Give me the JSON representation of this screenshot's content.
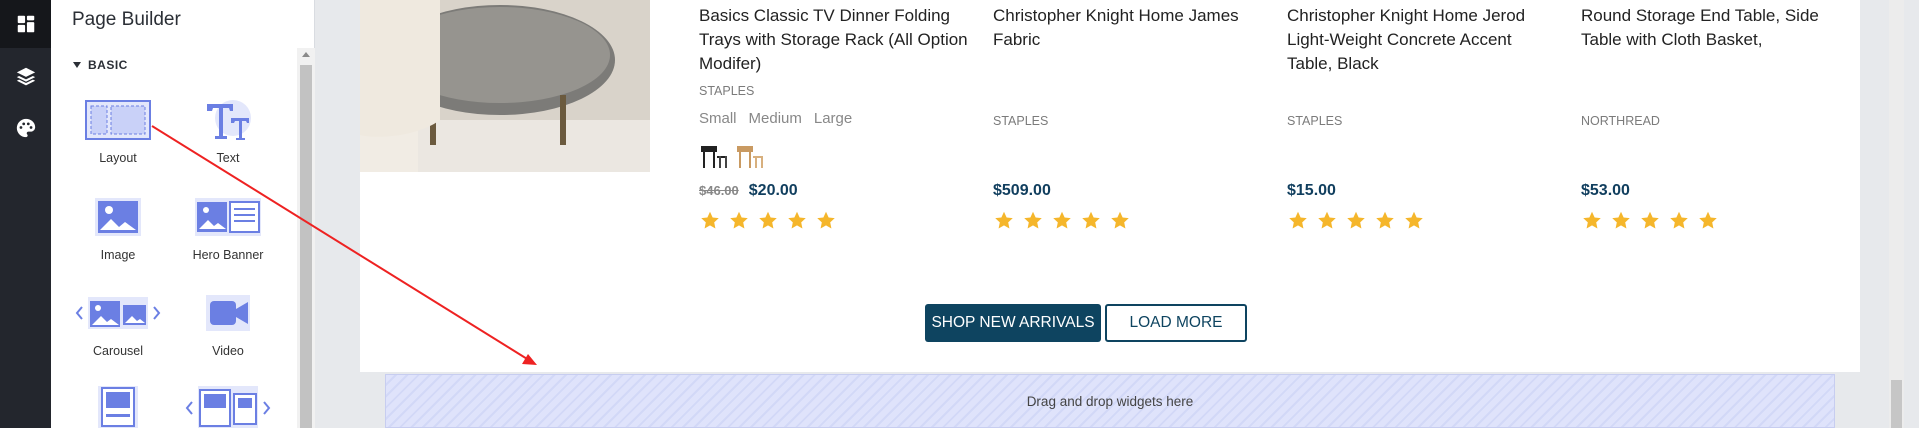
{
  "panel": {
    "title": "Page Builder",
    "section": "BASIC",
    "widgets": [
      {
        "label": "Layout",
        "icon": "layout-icon"
      },
      {
        "label": "Text",
        "icon": "text-icon"
      },
      {
        "label": "Image",
        "icon": "image-icon"
      },
      {
        "label": "Hero Banner",
        "icon": "hero-banner-icon"
      },
      {
        "label": "Carousel",
        "icon": "carousel-icon"
      },
      {
        "label": "Video",
        "icon": "video-icon"
      },
      {
        "label": "",
        "icon": "card-icon"
      },
      {
        "label": "",
        "icon": "card-carousel-icon"
      }
    ]
  },
  "rail": {
    "icons": [
      "dashboard-icon",
      "layers-icon",
      "palette-icon"
    ]
  },
  "products": [
    {
      "title": "Basics Classic TV Dinner Folding Trays with Storage Rack (All Option Modifer)",
      "brand": "STAPLES",
      "sizes": [
        "Small",
        "Medium",
        "Large"
      ],
      "old_price": "$46.00",
      "price": "$20.00",
      "rating": 5
    },
    {
      "title": "Christopher Knight Home James Fabric",
      "brand": "STAPLES",
      "price": "$509.00",
      "rating": 5
    },
    {
      "title": "Christopher Knight Home Jerod Light-Weight Concrete Accent Table, Black",
      "brand": "STAPLES",
      "price": "$15.00",
      "rating": 5
    },
    {
      "title": "Round Storage End Table, Side Table with Cloth Basket,",
      "brand": "NORTHREAD",
      "price": "$53.00",
      "rating": 5
    }
  ],
  "buttons": {
    "shop": "SHOP NEW ARRIVALS",
    "load_more": "LOAD MORE"
  },
  "dropzone": {
    "text": "Drag and drop widgets here"
  },
  "colors": {
    "accent": "#0e4460",
    "star": "#f5b62b",
    "rail": "#23262d",
    "widget_icon": "#6b7fe3"
  }
}
